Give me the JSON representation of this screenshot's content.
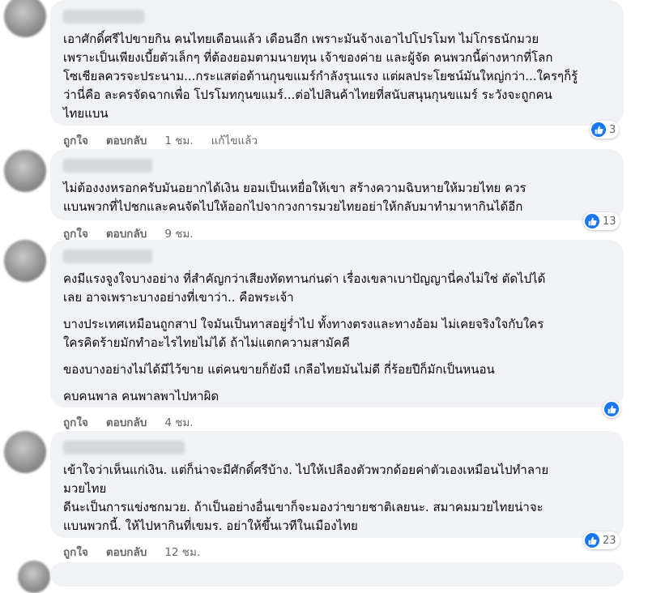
{
  "comments": [
    {
      "paragraphs": [
        "เอาศักดิ์ศรีไปขายกิน คนไทยเดือนแล้ว เดือนอีก เพราะมันจ้างเอาไปโปรโมท ไม่โกรธนักมวย\nเพราะเป็นเพียงเบี้ยตัวเล็กๆ ที่ต้องยอมตามนายทุน เจ้าของค่าย และผู้จัด คนพวกนี้ต่างหากที่โลก\nโซเชียลควรจะประนาม...กระแสต่อต้านกุนขแมร์กำลังรุนแรง แต่ผลประโยชน์มันใหญ่กว่า...ใครๆก็รู้\nว่านี่คือ ละครจัดฉากเพื่อ โปรโมทกุนขแมร์...ต่อไปสินค้าไทยที่สนับสนุนกุนขแมร์ ระวังจะถูกคน\nไทยแบน"
      ],
      "like": "ถูกใจ",
      "reply": "ตอบกลับ",
      "time": "1 ชม.",
      "edited": "แก้ไขแล้ว",
      "reactions": "3"
    },
    {
      "paragraphs": [
        "ไม่ต้องงงหรอกครับมันอยากได้เงิน ยอมเป็นเหยื่อให้เขา สร้างความฉิบหายให้มวยไทย ควร\nแบนพวกที่ไปชกและคนจัดไปให้ออกไปจากวงการมวยไทยอย่าให้กลับมาทำมาหากินได้อีก"
      ],
      "like": "ถูกใจ",
      "reply": "ตอบกลับ",
      "time": "9 ชม.",
      "reactions": "13"
    },
    {
      "paragraphs": [
        "คงมีแรงจูงใจบางอย่าง ที่สำคัญกว่าเสียงทัดทานก่นด่า เรื่องเขลาเบาปัญญานี่คงไม่ใช่ ตัดไปได้\nเลย อาจเพราะบางอย่างที่เขาว่า.. คือพระเจ้า",
        "บางประเทศเหมือนถูกสาป ใจมันเป็นทาสอยู่ร่ำไป ทั้งทางตรงและทางอ้อม ไม่เคยจริงใจกับใคร\nใครคิดร้ายมักทำอะไรไทยไม่ได้ ถ้าไม่แตกความสามัคคี",
        "ของบางอย่างไม่ได้มีไว้ขาย แต่คนขายก็ยังมี เกลือไทยมันไม่ดี กี่ร้อยปีก็มักเป็นหนอน",
        "คบคนพาล คนพาลพาไปหาผิด"
      ],
      "like": "ถูกใจ",
      "reply": "ตอบกลับ",
      "time": "4 ชม.",
      "reactions": ""
    },
    {
      "paragraphs": [
        "เข้าใจว่าเห็นแก่เงิน. แต่ก็น่าจะมีศักดิ์ศรีบ้าง. ไปให้เปลืองตัวพวกด้อยค่าตัวเองเหมือนไปทำลาย\nมวยไทย\nดีนะเป็นการแข่งชกมวย. ถ้าเป็นอย่างอื่นเขาก็จะมองว่าขายชาติเลยนะ. สมาคมมวยไทยน่าจะ\nแบนพวกนี้. ให้ไปหากินที่เขมร. อย่าให้ขึ้นเวทีในเมืองไทย"
      ],
      "like": "ถูกใจ",
      "reply": "ตอบกลับ",
      "time": "12 ชม.",
      "reactions": "23"
    }
  ],
  "colors": {
    "bubble": "#f0f2f5",
    "like_blue": "#1877f2",
    "meta": "#65676b"
  }
}
